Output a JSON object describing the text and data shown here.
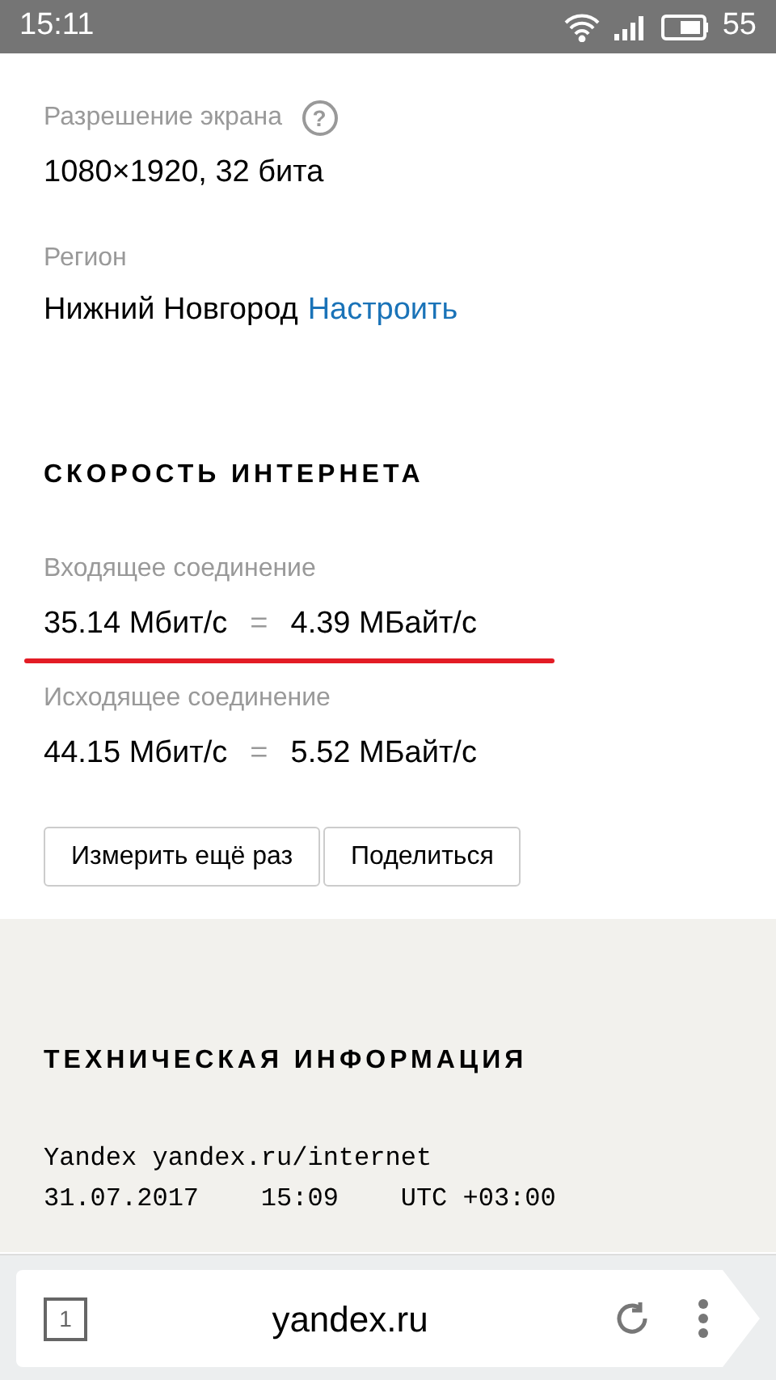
{
  "status_bar": {
    "time": "15:11",
    "battery": "55"
  },
  "screen_resolution": {
    "label": "Разрешение экрана",
    "help_icon": "?",
    "value": "1080×1920, 32 бита"
  },
  "region": {
    "label": "Регион",
    "value": "Нижний Новгород",
    "link": "Настроить"
  },
  "speed": {
    "heading": "СКОРОСТЬ ИНТЕРНЕТА",
    "rows": [
      {
        "label": "Входящее соединение",
        "mbit": "35.14 Мбит/с",
        "equals": "=",
        "mbyte": "4.39 МБайт/с",
        "underlined": true
      },
      {
        "label": "Исходящее соединение",
        "mbit": "44.15 Мбит/с",
        "equals": "=",
        "mbyte": "5.52 МБайт/с",
        "underlined": false
      }
    ],
    "buttons": [
      "Измерить ещё раз",
      "Поделиться"
    ]
  },
  "tech_info": {
    "heading": "ТЕХНИЧЕСКАЯ ИНФОРМАЦИЯ",
    "lines": [
      "Yandex yandex.ru/internet",
      "31.07.2017    15:09    UTC +03:00"
    ]
  },
  "browser_bar": {
    "tab_count": "1",
    "url": "yandex.ru"
  }
}
